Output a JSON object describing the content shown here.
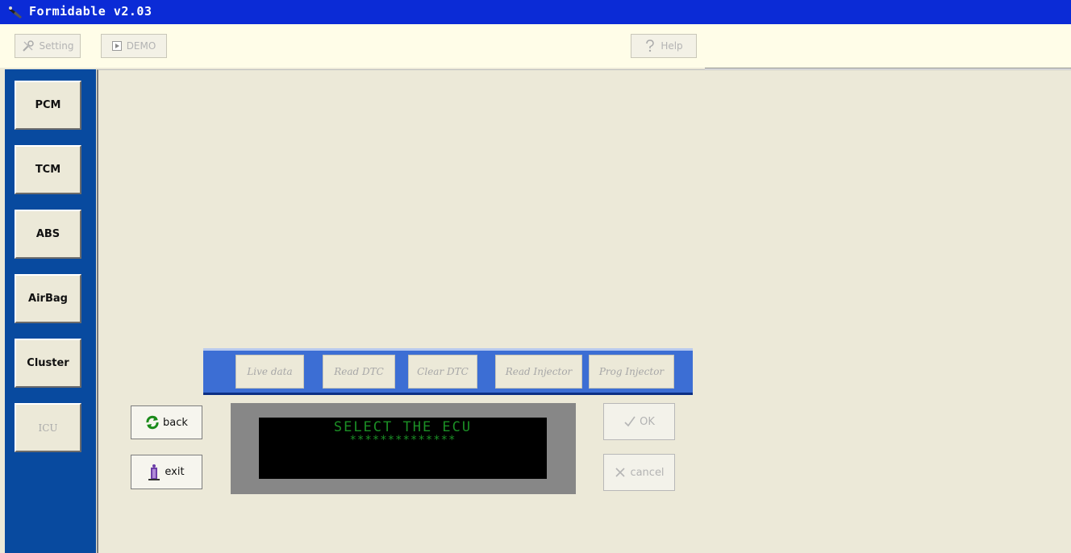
{
  "window": {
    "title": "Formidable v2.03"
  },
  "toolbar": {
    "setting_label": "Setting",
    "demo_label": "DEMO",
    "help_label": "Help"
  },
  "sidebar": {
    "items": [
      {
        "label": "PCM"
      },
      {
        "label": "TCM"
      },
      {
        "label": "ABS"
      },
      {
        "label": "AirBag"
      },
      {
        "label": "Cluster"
      },
      {
        "label": "ICU"
      }
    ]
  },
  "functions": {
    "items": [
      {
        "label": "Live data"
      },
      {
        "label": "Read DTC"
      },
      {
        "label": "Clear DTC"
      },
      {
        "label": "Read Injector"
      },
      {
        "label": "Prog Injector"
      }
    ]
  },
  "nav": {
    "back_label": "back",
    "exit_label": "exit"
  },
  "display": {
    "line1": "SELECT THE ECU",
    "line2": "**************"
  },
  "actions": {
    "ok_label": "OK",
    "cancel_label": "cancel"
  },
  "icons": {
    "app": "app-icon",
    "setting": "tools-icon",
    "demo": "play-icon",
    "help": "question-icon",
    "back": "refresh-icon",
    "exit": "door-exit-icon",
    "ok": "checkmark-icon",
    "cancel": "x-icon"
  }
}
